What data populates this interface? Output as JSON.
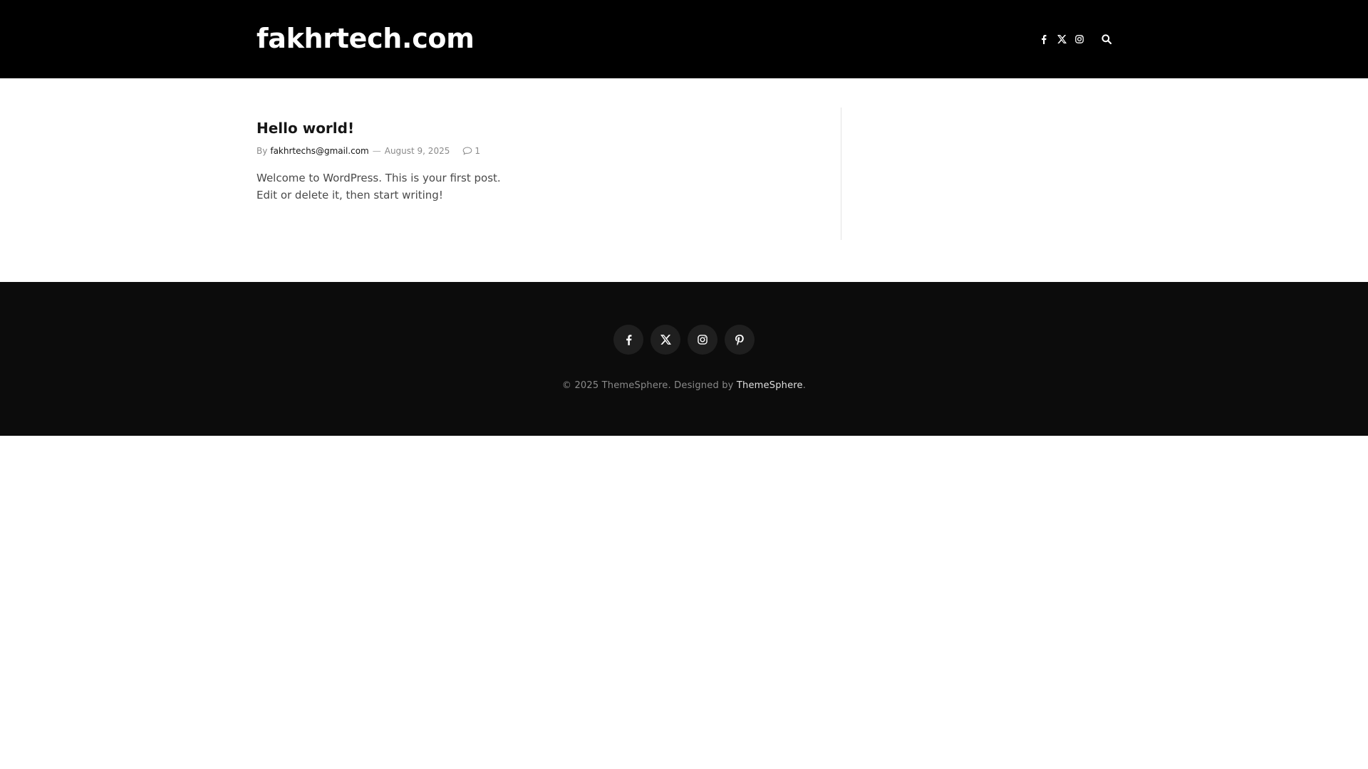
{
  "header": {
    "site_title": "fakhrtech.com",
    "icons": [
      "facebook-icon",
      "x-twitter-icon",
      "instagram-icon",
      "search-icon"
    ]
  },
  "post": {
    "title": "Hello world!",
    "by_label": "By",
    "author": "fakhrtechs@gmail.com",
    "separator": "—",
    "date": "August 9, 2025",
    "comment_count": "1",
    "excerpt_line1": "Welcome to WordPress. This is your first post.",
    "excerpt_line2": "Edit or delete it, then start writing!"
  },
  "footer": {
    "social": [
      "facebook-icon",
      "x-twitter-icon",
      "instagram-icon",
      "pinterest-icon"
    ],
    "copyright_prefix": "© 2025 ThemeSphere. Designed by ",
    "copyright_link": "ThemeSphere",
    "copyright_suffix": "."
  },
  "colors": {
    "header_bg": "#000000",
    "footer_bg": "#0c0c0c",
    "social_btn_bg": "#1f1f1f"
  }
}
